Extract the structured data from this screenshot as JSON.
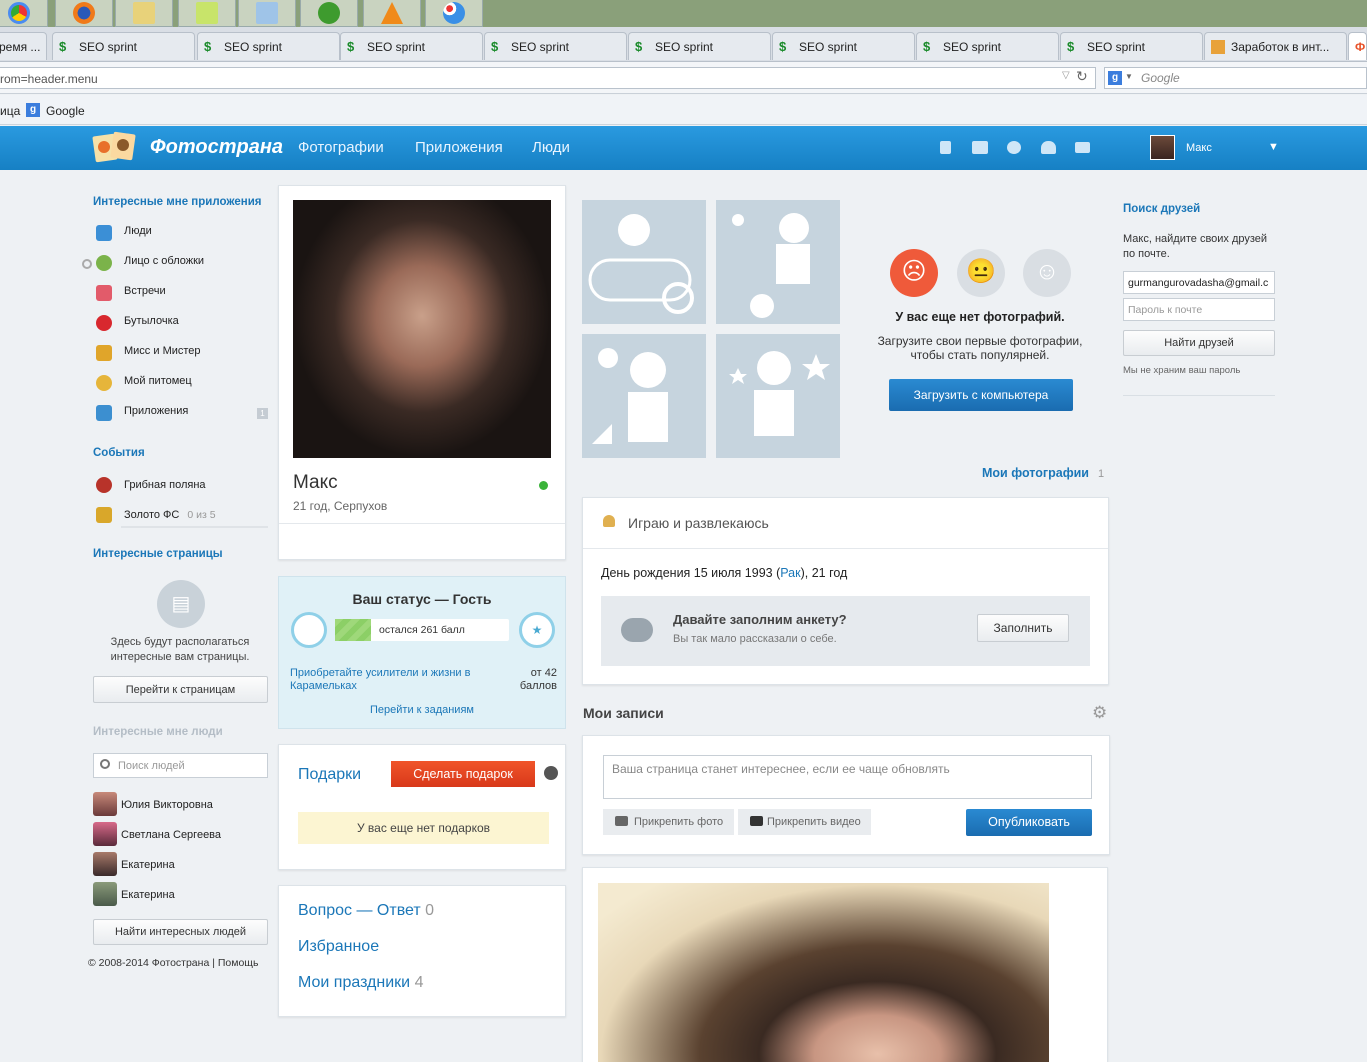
{
  "browser": {
    "tabs": [
      {
        "label": "ремя ..."
      },
      {
        "label": "SEO sprint"
      },
      {
        "label": "SEO sprint"
      },
      {
        "label": "SEO sprint"
      },
      {
        "label": "SEO sprint"
      },
      {
        "label": "SEO sprint"
      },
      {
        "label": "SEO sprint"
      },
      {
        "label": "SEO sprint"
      },
      {
        "label": "SEO sprint"
      },
      {
        "label": "Заработок в инт..."
      },
      {
        "label": "Ф"
      }
    ],
    "url": "rom=header.menu",
    "search_placeholder": "Google",
    "bookmarks": [
      {
        "label": "ица"
      },
      {
        "label": "Google"
      }
    ]
  },
  "header": {
    "logo": "Фотострана",
    "nav": [
      "Фотографии",
      "Приложения",
      "Люди"
    ],
    "user_name": "Макс"
  },
  "left": {
    "apps_title": "Интересные мне приложения",
    "apps": [
      {
        "label": "Люди",
        "color": "#3b8fd6"
      },
      {
        "label": "Лицо с обложки",
        "color": "#7bb34a"
      },
      {
        "label": "Встречи",
        "color": "#e25b6a"
      },
      {
        "label": "Бутылочка",
        "color": "#d8282e"
      },
      {
        "label": "Мисс и Мистер",
        "color": "#e0a52a"
      },
      {
        "label": "Мой питомец",
        "color": "#e6b53a"
      },
      {
        "label": "Приложения",
        "color": "#3c8fd0"
      }
    ],
    "apps_badge": "1",
    "events_title": "События",
    "events": [
      {
        "label": "Грибная поляна",
        "extra": ""
      },
      {
        "label": "Золото ФС",
        "extra": "0 из 5"
      }
    ],
    "pages_title": "Интересные страницы",
    "pages_text": "Здесь будут располагаться интересные вам страницы.",
    "pages_button": "Перейти к страницам",
    "people_title": "Интересные мне люди",
    "people_search_placeholder": "Поиск людей",
    "people": [
      "Юлия Викторовна",
      "Светлана Сергеева",
      "Екатерина",
      "Екатерина"
    ],
    "people_button": "Найти интересных людей",
    "footer": "© 2008-2014 Фотострана",
    "footer_link": "Помощь"
  },
  "profile": {
    "name": "Макс",
    "details": "21 год, Серпухов",
    "status_title": "Ваш статус — Гость",
    "status_left": "остался 261 балл",
    "boost_text": "Приобретайте усилители и жизни в Карамельках",
    "boost_value": "от 42 баллов",
    "tasks_link": "Перейти к заданиям",
    "gifts_title": "Подарки",
    "gift_button": "Сделать подарок",
    "no_gifts": "У вас еще нет подарков",
    "links": [
      {
        "label": "Вопрос — Ответ",
        "count": "0"
      },
      {
        "label": "Избранное",
        "count": ""
      },
      {
        "label": "Мои праздники",
        "count": "4"
      }
    ]
  },
  "photos": {
    "no_photos_title": "У вас еще нет фотографий.",
    "no_photos_text": "Загрузите свои первые фотографии, чтобы стать популярней.",
    "upload_button": "Загрузить с компьютера",
    "my_photos": "Мои фотографии",
    "my_photos_count": "1"
  },
  "about": {
    "title": "Играю и развлекаюсь",
    "birthday_prefix": "День рождения 15 июля 1993 (",
    "zodiac": "Рак",
    "birthday_suffix": "), 21 год",
    "fill_title": "Давайте заполним анкету?",
    "fill_sub": "Вы так мало рассказали о себе.",
    "fill_button": "Заполнить"
  },
  "posts": {
    "title": "Мои записи",
    "placeholder": "Ваша страница станет интереснее, если ее чаще обновлять",
    "attach_photo": "Прикрепить фото",
    "attach_video": "Прикрепить видео",
    "publish": "Опубликовать"
  },
  "right": {
    "title": "Поиск друзей",
    "text": "Макс, найдите своих друзей по почте.",
    "email_value": "gurmangurovadasha@gmail.c",
    "password_placeholder": "Пароль к почте",
    "button": "Найти друзей",
    "note": "Мы не храним ваш пароль"
  }
}
